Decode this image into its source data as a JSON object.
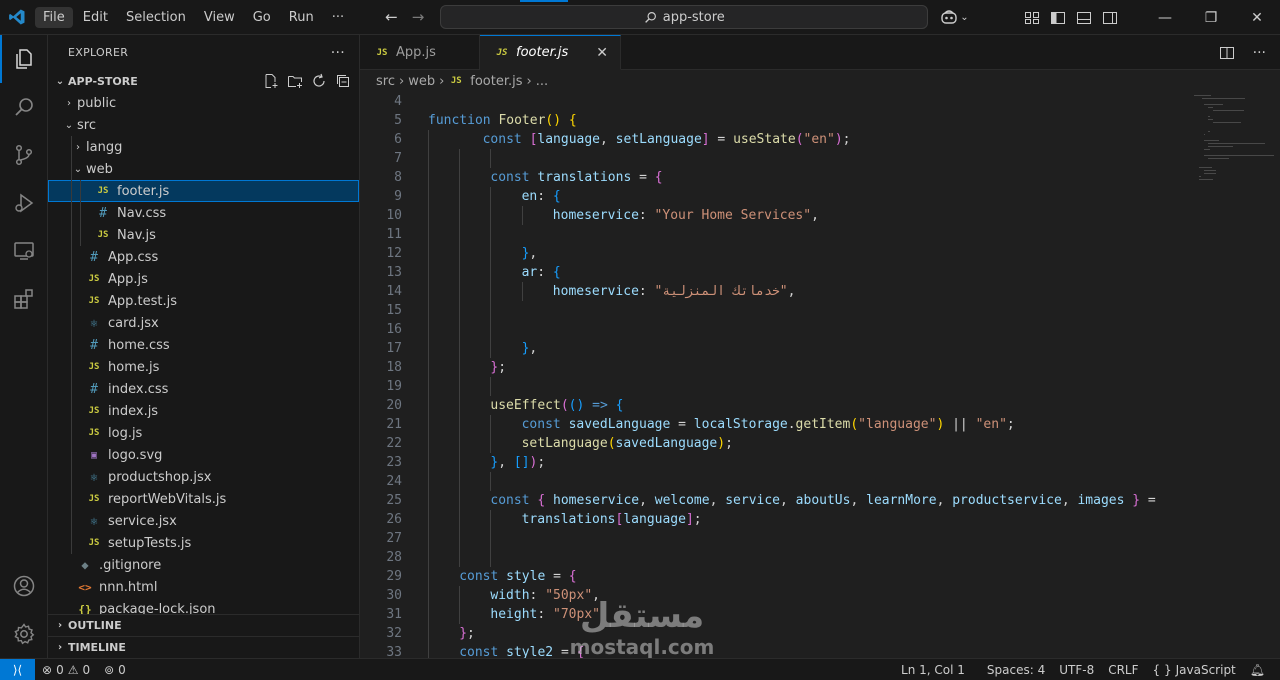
{
  "titlebar": {
    "menu": [
      "File",
      "Edit",
      "Selection",
      "View",
      "Go",
      "Run",
      "···"
    ],
    "search_text": "app-store"
  },
  "sidebar": {
    "header": "EXPLORER",
    "more": "···",
    "root": "APP-STORE",
    "tree": [
      {
        "name": "public",
        "type": "folder",
        "depth": 1,
        "open": false
      },
      {
        "name": "src",
        "type": "folder",
        "depth": 1,
        "open": true
      },
      {
        "name": "langg",
        "type": "folder",
        "depth": 2,
        "open": false
      },
      {
        "name": "web",
        "type": "folder",
        "depth": 2,
        "open": true
      },
      {
        "name": "footer.js",
        "type": "js",
        "depth": 3,
        "selected": true
      },
      {
        "name": "Nav.css",
        "type": "css",
        "depth": 3
      },
      {
        "name": "Nav.js",
        "type": "js",
        "depth": 3
      },
      {
        "name": "App.css",
        "type": "css",
        "depth": 2
      },
      {
        "name": "App.js",
        "type": "js",
        "depth": 2
      },
      {
        "name": "App.test.js",
        "type": "js",
        "depth": 2
      },
      {
        "name": "card.jsx",
        "type": "react",
        "depth": 2
      },
      {
        "name": "home.css",
        "type": "css",
        "depth": 2
      },
      {
        "name": "home.js",
        "type": "js",
        "depth": 2
      },
      {
        "name": "index.css",
        "type": "css",
        "depth": 2
      },
      {
        "name": "index.js",
        "type": "js",
        "depth": 2
      },
      {
        "name": "log.js",
        "type": "js",
        "depth": 2
      },
      {
        "name": "logo.svg",
        "type": "svg",
        "depth": 2
      },
      {
        "name": "productshop.jsx",
        "type": "react",
        "depth": 2
      },
      {
        "name": "reportWebVitals.js",
        "type": "js",
        "depth": 2
      },
      {
        "name": "service.jsx",
        "type": "react",
        "depth": 2
      },
      {
        "name": "setupTests.js",
        "type": "js",
        "depth": 2
      },
      {
        "name": ".gitignore",
        "type": "git",
        "depth": 1
      },
      {
        "name": "nnn.html",
        "type": "html",
        "depth": 1
      },
      {
        "name": "package-lock.json",
        "type": "json",
        "depth": 1
      }
    ],
    "sections": [
      "OUTLINE",
      "TIMELINE"
    ]
  },
  "editor": {
    "tabs": [
      {
        "label": "App.js",
        "active": false
      },
      {
        "label": "footer.js",
        "active": true
      }
    ],
    "breadcrumb": [
      "src",
      "web",
      "footer.js",
      "..."
    ]
  },
  "code": [
    {
      "n": "4",
      "indent": 0,
      "t": []
    },
    {
      "n": "5",
      "indent": 0,
      "t": [
        [
          "kw",
          "function "
        ],
        [
          "fn",
          "Footer"
        ],
        [
          "br1",
          "() {"
        ]
      ]
    },
    {
      "n": "6",
      "indent": 7,
      "t": [
        [
          "kw",
          "const "
        ],
        [
          "br2",
          "["
        ],
        [
          "var",
          "language"
        ],
        [
          "op",
          ", "
        ],
        [
          "var",
          "setLanguage"
        ],
        [
          "br2",
          "]"
        ],
        [
          "op",
          " = "
        ],
        [
          "fn",
          "useState"
        ],
        [
          "br2",
          "("
        ],
        [
          "str",
          "\"en\""
        ],
        [
          "br2",
          ")"
        ],
        [
          "op",
          ";"
        ]
      ]
    },
    {
      "n": "7",
      "indent": 0,
      "t": []
    },
    {
      "n": "8",
      "indent": 8,
      "t": [
        [
          "kw",
          "const "
        ],
        [
          "var",
          "translations"
        ],
        [
          "op",
          " = "
        ],
        [
          "br2",
          "{"
        ]
      ]
    },
    {
      "n": "9",
      "indent": 12,
      "t": [
        [
          "var",
          "en"
        ],
        [
          "op",
          ": "
        ],
        [
          "br3",
          "{"
        ]
      ]
    },
    {
      "n": "10",
      "indent": 16,
      "t": [
        [
          "var",
          "homeservice"
        ],
        [
          "op",
          ": "
        ],
        [
          "str",
          "\"Your Home Services\""
        ],
        [
          "op",
          ","
        ]
      ]
    },
    {
      "n": "11",
      "indent": 0,
      "t": []
    },
    {
      "n": "12",
      "indent": 12,
      "t": [
        [
          "br3",
          "}"
        ],
        [
          "op",
          ","
        ]
      ]
    },
    {
      "n": "13",
      "indent": 12,
      "t": [
        [
          "var",
          "ar"
        ],
        [
          "op",
          ": "
        ],
        [
          "br3",
          "{"
        ]
      ]
    },
    {
      "n": "14",
      "indent": 16,
      "t": [
        [
          "var",
          "homeservice"
        ],
        [
          "op",
          ": "
        ],
        [
          "str",
          "\"خدماتك المنزلية\""
        ],
        [
          "op",
          ","
        ]
      ]
    },
    {
      "n": "15",
      "indent": 0,
      "t": []
    },
    {
      "n": "16",
      "indent": 0,
      "t": []
    },
    {
      "n": "17",
      "indent": 12,
      "t": [
        [
          "br3",
          "}"
        ],
        [
          "op",
          ","
        ]
      ]
    },
    {
      "n": "18",
      "indent": 8,
      "t": [
        [
          "br2",
          "}"
        ],
        [
          "op",
          ";"
        ]
      ]
    },
    {
      "n": "19",
      "indent": 0,
      "t": []
    },
    {
      "n": "20",
      "indent": 8,
      "t": [
        [
          "fn",
          "useEffect"
        ],
        [
          "br2",
          "("
        ],
        [
          "br3",
          "()"
        ],
        [
          "kw",
          " => "
        ],
        [
          "br3",
          "{"
        ]
      ]
    },
    {
      "n": "21",
      "indent": 12,
      "t": [
        [
          "kw",
          "const "
        ],
        [
          "var",
          "savedLanguage"
        ],
        [
          "op",
          " = "
        ],
        [
          "var",
          "localStorage"
        ],
        [
          "op",
          "."
        ],
        [
          "fn",
          "getItem"
        ],
        [
          "br1",
          "("
        ],
        [
          "str",
          "\"language\""
        ],
        [
          "br1",
          ")"
        ],
        [
          "op",
          " || "
        ],
        [
          "str",
          "\"en\""
        ],
        [
          "op",
          ";"
        ]
      ]
    },
    {
      "n": "22",
      "indent": 12,
      "t": [
        [
          "fn",
          "setLanguage"
        ],
        [
          "br1",
          "("
        ],
        [
          "var",
          "savedLanguage"
        ],
        [
          "br1",
          ")"
        ],
        [
          "op",
          ";"
        ]
      ]
    },
    {
      "n": "23",
      "indent": 8,
      "t": [
        [
          "br3",
          "}"
        ],
        [
          "op",
          ", "
        ],
        [
          "br3",
          "[]"
        ],
        [
          "br2",
          ")"
        ],
        [
          "op",
          ";"
        ]
      ]
    },
    {
      "n": "24",
      "indent": 0,
      "t": []
    },
    {
      "n": "25",
      "indent": 8,
      "t": [
        [
          "kw",
          "const "
        ],
        [
          "br2",
          "{ "
        ],
        [
          "var",
          "homeservice"
        ],
        [
          "op",
          ", "
        ],
        [
          "var",
          "welcome"
        ],
        [
          "op",
          ", "
        ],
        [
          "var",
          "service"
        ],
        [
          "op",
          ", "
        ],
        [
          "var",
          "aboutUs"
        ],
        [
          "op",
          ", "
        ],
        [
          "var",
          "learnMore"
        ],
        [
          "op",
          ", "
        ],
        [
          "var",
          "productservice"
        ],
        [
          "op",
          ", "
        ],
        [
          "var",
          "images"
        ],
        [
          "br2",
          " }"
        ],
        [
          "op",
          " ="
        ]
      ]
    },
    {
      "n": "26",
      "indent": 12,
      "t": [
        [
          "var",
          "translations"
        ],
        [
          "br2",
          "["
        ],
        [
          "var",
          "language"
        ],
        [
          "br2",
          "]"
        ],
        [
          "op",
          ";"
        ]
      ]
    },
    {
      "n": "27",
      "indent": 0,
      "t": []
    },
    {
      "n": "28",
      "indent": 0,
      "t": []
    },
    {
      "n": "29",
      "indent": 4,
      "t": [
        [
          "kw",
          "const "
        ],
        [
          "var",
          "style"
        ],
        [
          "op",
          " = "
        ],
        [
          "br2",
          "{"
        ]
      ]
    },
    {
      "n": "30",
      "indent": 8,
      "t": [
        [
          "var",
          "width"
        ],
        [
          "op",
          ": "
        ],
        [
          "str",
          "\"50px\""
        ],
        [
          "op",
          ","
        ]
      ]
    },
    {
      "n": "31",
      "indent": 8,
      "t": [
        [
          "var",
          "height"
        ],
        [
          "op",
          ": "
        ],
        [
          "str",
          "\"70px\""
        ]
      ]
    },
    {
      "n": "32",
      "indent": 4,
      "t": [
        [
          "br2",
          "}"
        ],
        [
          "op",
          ";"
        ]
      ]
    },
    {
      "n": "33",
      "indent": 4,
      "t": [
        [
          "kw",
          "const "
        ],
        [
          "var",
          "style2"
        ],
        [
          "op",
          " = "
        ],
        [
          "br2",
          "{"
        ]
      ]
    }
  ],
  "watermark": {
    "arabic": "مستقل",
    "latin": "mostaql.com"
  },
  "statusbar": {
    "errors": "0",
    "warnings": "0",
    "ports": "0",
    "position": "Ln 1, Col 1",
    "spaces": "Spaces: 4",
    "encoding": "UTF-8",
    "eol": "CRLF",
    "language": "JavaScript"
  },
  "colors": {
    "accent": "#0078d4",
    "keyword": "#569cd6",
    "function": "#dcdcaa",
    "variable": "#9cdcfe",
    "string": "#ce9178"
  },
  "icons": [
    "vscode-logo-icon",
    "explorer-icon",
    "search-icon",
    "source-control-icon",
    "run-debug-icon",
    "remote-explorer-icon",
    "extensions-icon",
    "account-icon",
    "settings-gear-icon",
    "copilot-icon"
  ]
}
